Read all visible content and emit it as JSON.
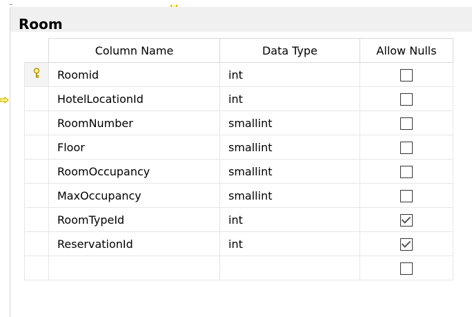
{
  "table": {
    "title": "Room",
    "columns": {
      "col1": "Column Name",
      "col2": "Data Type",
      "col3": "Allow Nulls"
    },
    "rows": [
      {
        "name": "Roomid",
        "type": "int",
        "allow_nulls": false,
        "primary_key": true
      },
      {
        "name": "HotelLocationId",
        "type": "int",
        "allow_nulls": false,
        "primary_key": false
      },
      {
        "name": "RoomNumber",
        "type": "smallint",
        "allow_nulls": false,
        "primary_key": false
      },
      {
        "name": "Floor",
        "type": "smallint",
        "allow_nulls": false,
        "primary_key": false
      },
      {
        "name": "RoomOccupancy",
        "type": "smallint",
        "allow_nulls": false,
        "primary_key": false
      },
      {
        "name": "MaxOccupancy",
        "type": "smallint",
        "allow_nulls": false,
        "primary_key": false
      },
      {
        "name": "RoomTypeId",
        "type": "int",
        "allow_nulls": true,
        "primary_key": false
      },
      {
        "name": "ReservationId",
        "type": "int",
        "allow_nulls": true,
        "primary_key": false
      },
      {
        "name": "",
        "type": "",
        "allow_nulls": false,
        "primary_key": false
      }
    ]
  },
  "icons": {
    "primary_key": "key-icon",
    "relationship": "relationship-key-icon"
  },
  "colors": {
    "key": "#d8b800",
    "title_bar": "#f0f0f0"
  }
}
